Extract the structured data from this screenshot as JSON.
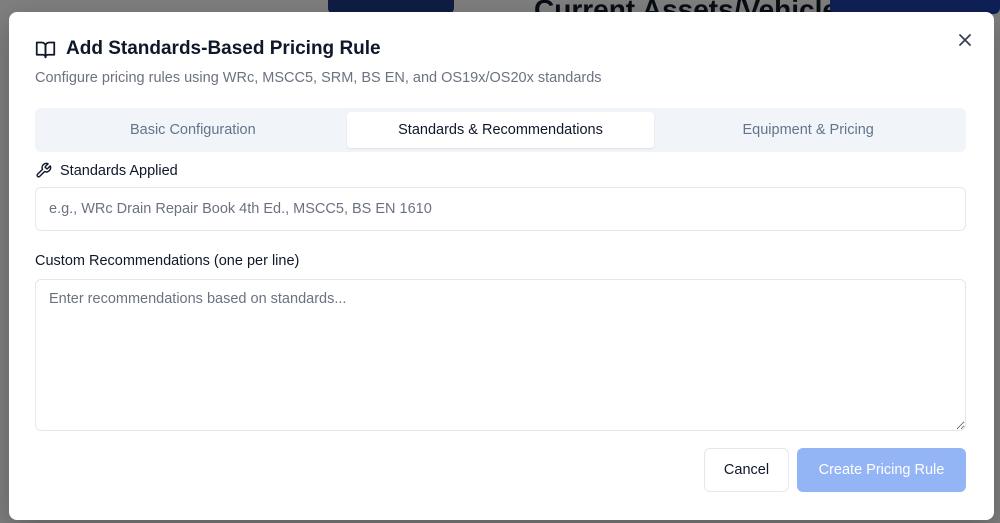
{
  "background": {
    "heading": "Current Assets/Vehicles"
  },
  "dialog": {
    "title": "Add Standards-Based Pricing Rule",
    "title_icon": "book-open-icon",
    "subtitle": "Configure pricing rules using WRc, MSCC5, SRM, BS EN, and OS19x/OS20x standards",
    "close_icon": "close-icon",
    "tabs": [
      {
        "label": "Basic Configuration",
        "active": false
      },
      {
        "label": "Standards & Recommendations",
        "active": true
      },
      {
        "label": "Equipment & Pricing",
        "active": false
      }
    ],
    "standards_field": {
      "label": "Standards Applied",
      "icon": "wrench-icon",
      "value": "",
      "placeholder": "e.g., WRc Drain Repair Book 4th Ed., MSCC5, BS EN 1610"
    },
    "recommendations_field": {
      "label": "Custom Recommendations (one per line)",
      "value": "",
      "placeholder": "Enter recommendations based on standards..."
    },
    "buttons": {
      "cancel": "Cancel",
      "create": "Create Pricing Rule"
    }
  },
  "colors": {
    "primary_disabled": "#93b4f5",
    "overlay": "rgba(0,0,0,0.5)"
  }
}
